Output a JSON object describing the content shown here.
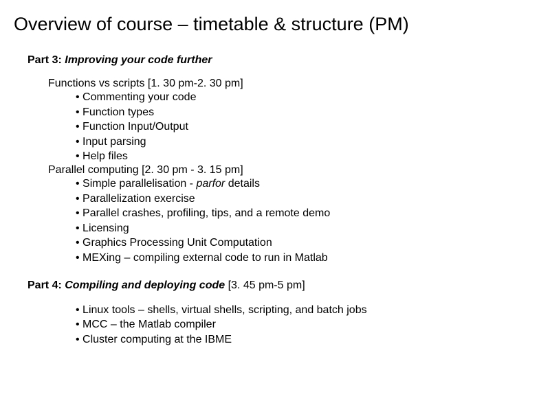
{
  "title": "Overview of course – timetable & structure (PM)",
  "part3": {
    "label": "Part 3: ",
    "title": "Improving your code further",
    "topic1": {
      "heading": "Functions vs scripts [1. 30 pm-2. 30 pm]",
      "items": [
        "Commenting your code",
        "Function types",
        "Function Input/Output",
        "Input parsing",
        "Help files"
      ]
    },
    "topic2": {
      "heading": "Parallel computing [2. 30 pm - 3. 15 pm]",
      "item0_pre": "Simple parallelisation - ",
      "item0_em": "parfor",
      "item0_post": " details",
      "items_rest": [
        "Parallelization exercise",
        "Parallel crashes, profiling, tips, and a remote demo",
        "Licensing",
        "Graphics Processing Unit Computation",
        "MEXing – compiling external code to run in Matlab"
      ]
    }
  },
  "part4": {
    "label": "Part 4: ",
    "title": "Compiling and deploying code",
    "time": " [3. 45 pm-5 pm]",
    "items": [
      "Linux tools – shells, virtual shells, scripting, and batch jobs",
      "MCC – the Matlab compiler",
      "Cluster computing at the IBME"
    ]
  }
}
